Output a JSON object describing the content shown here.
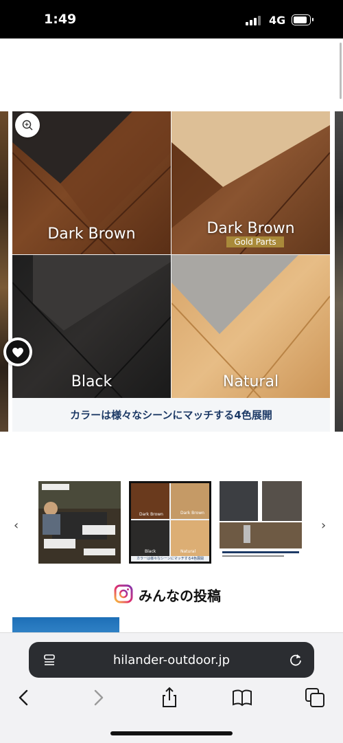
{
  "status_bar": {
    "time": "1:49",
    "network": "4G"
  },
  "gallery": {
    "swatches": [
      {
        "label": "Dark Brown",
        "sublabel": ""
      },
      {
        "label": "Dark Brown",
        "sublabel": "Gold Parts"
      },
      {
        "label": "Black",
        "sublabel": ""
      },
      {
        "label": "Natural",
        "sublabel": ""
      }
    ],
    "caption": "カラーは様々なシーンにマッチする4色展開"
  },
  "thumbnails": {
    "prev_icon": "‹",
    "next_icon": "›",
    "items": [
      {
        "name": "thumbnail-camp-table-scene"
      },
      {
        "name": "thumbnail-color-variations",
        "labels": [
          "Dark Brown",
          "Dark Brown",
          "Black",
          "Natural"
        ],
        "sublabel": "Gold Parts",
        "caption": "カラーは様々なシーンにマッチする4色展開"
      },
      {
        "name": "thumbnail-accessories"
      }
    ],
    "selected_index": 1
  },
  "community": {
    "title": "みんなの投稿",
    "icon": "instagram-icon"
  },
  "browser": {
    "url": "hilander-outdoor.jp",
    "toolbar": [
      "back-icon",
      "forward-icon",
      "share-icon",
      "bookmarks-icon",
      "tabs-icon"
    ]
  },
  "colors": {
    "caption_text": "#1d3a66",
    "gold_tag": "#a98a3a",
    "url_bar": "#2b2d31"
  }
}
